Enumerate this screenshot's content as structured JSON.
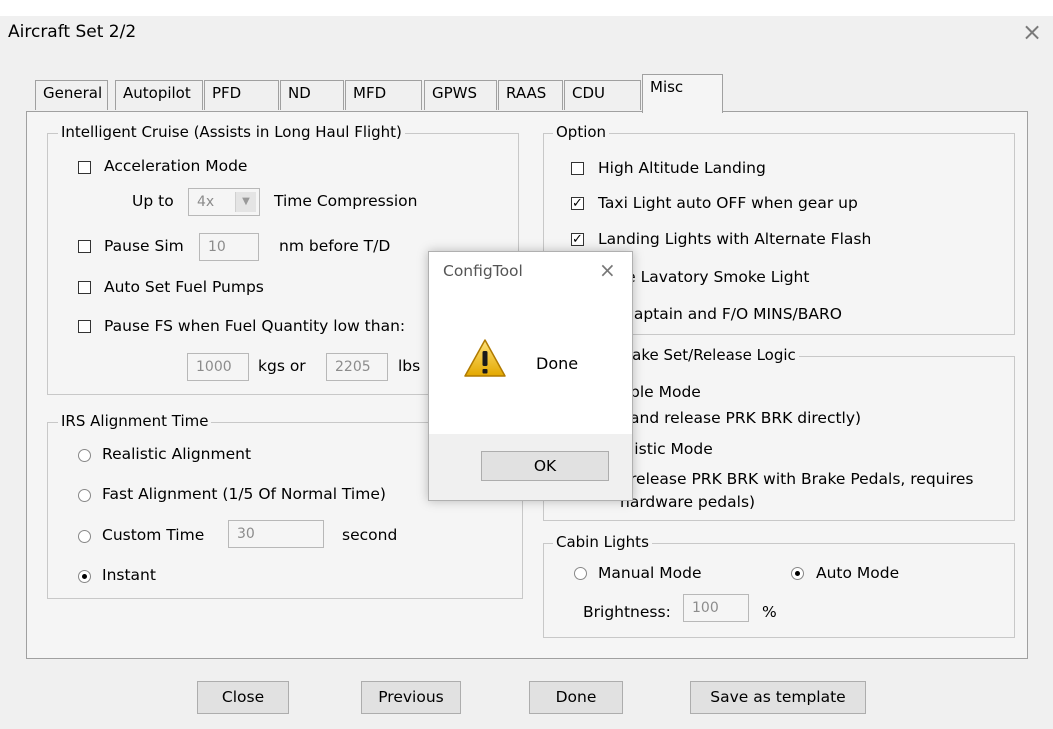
{
  "window": {
    "title": "Aircraft Set 2/2",
    "close_icon": "×"
  },
  "tabs": [
    "General",
    "Autopilot",
    "PFD",
    "ND",
    "MFD",
    "GPWS",
    "RAAS",
    "CDU",
    "Misc"
  ],
  "active_tab": "Misc",
  "intelligent_cruise": {
    "legend": "Intelligent Cruise (Assists in Long Haul Flight)",
    "acceleration_mode": "Acceleration Mode",
    "up_to": "Up to",
    "compression_value": "4x",
    "time_compression": "Time Compression",
    "pause_sim": "Pause Sim",
    "pause_sim_value": "10",
    "nm_before_td": "nm before T/D",
    "auto_set_fuel_pumps": "Auto Set Fuel Pumps",
    "pause_fs": "Pause FS when Fuel Quantity low than:",
    "kgs_value": "1000",
    "kgs_or": "kgs or",
    "lbs_value": "2205",
    "lbs": "lbs"
  },
  "irs": {
    "legend": "IRS Alignment Time",
    "realistic": "Realistic Alignment",
    "fast": "Fast Alignment (1/5 Of Normal Time)",
    "custom": "Custom Time",
    "custom_value": "30",
    "second": "second",
    "instant": "Instant"
  },
  "option": {
    "legend": "Option",
    "high_altitude_landing": "High Altitude Landing",
    "taxi_light": "Taxi Light auto OFF when gear up",
    "landing_lights": "Landing Lights with Alternate Flash",
    "lavatory": "ble Lavatory Smoke Light",
    "captain_fo": "t Captain and F/O MINS/BARO"
  },
  "brake": {
    "legend": "rake Set/Release Logic",
    "simple_mode": "ble Mode",
    "simple_desc": "and release PRK BRK directly)",
    "realistic_mode": "listic Mode",
    "realistic_desc1": "release PRK BRK with Brake Pedals, requires",
    "realistic_desc2": "hardware pedals)"
  },
  "cabin_lights": {
    "legend": "Cabin Lights",
    "manual": "Manual Mode",
    "auto": "Auto Mode",
    "brightness": "Brightness:",
    "brightness_value": "100",
    "percent": "%"
  },
  "buttons": {
    "close": "Close",
    "previous": "Previous",
    "done": "Done",
    "save_template": "Save as template"
  },
  "dialog": {
    "title": "ConfigTool",
    "close_icon": "×",
    "message": "Done",
    "ok": "OK",
    "warning_icon": "warning-icon"
  }
}
